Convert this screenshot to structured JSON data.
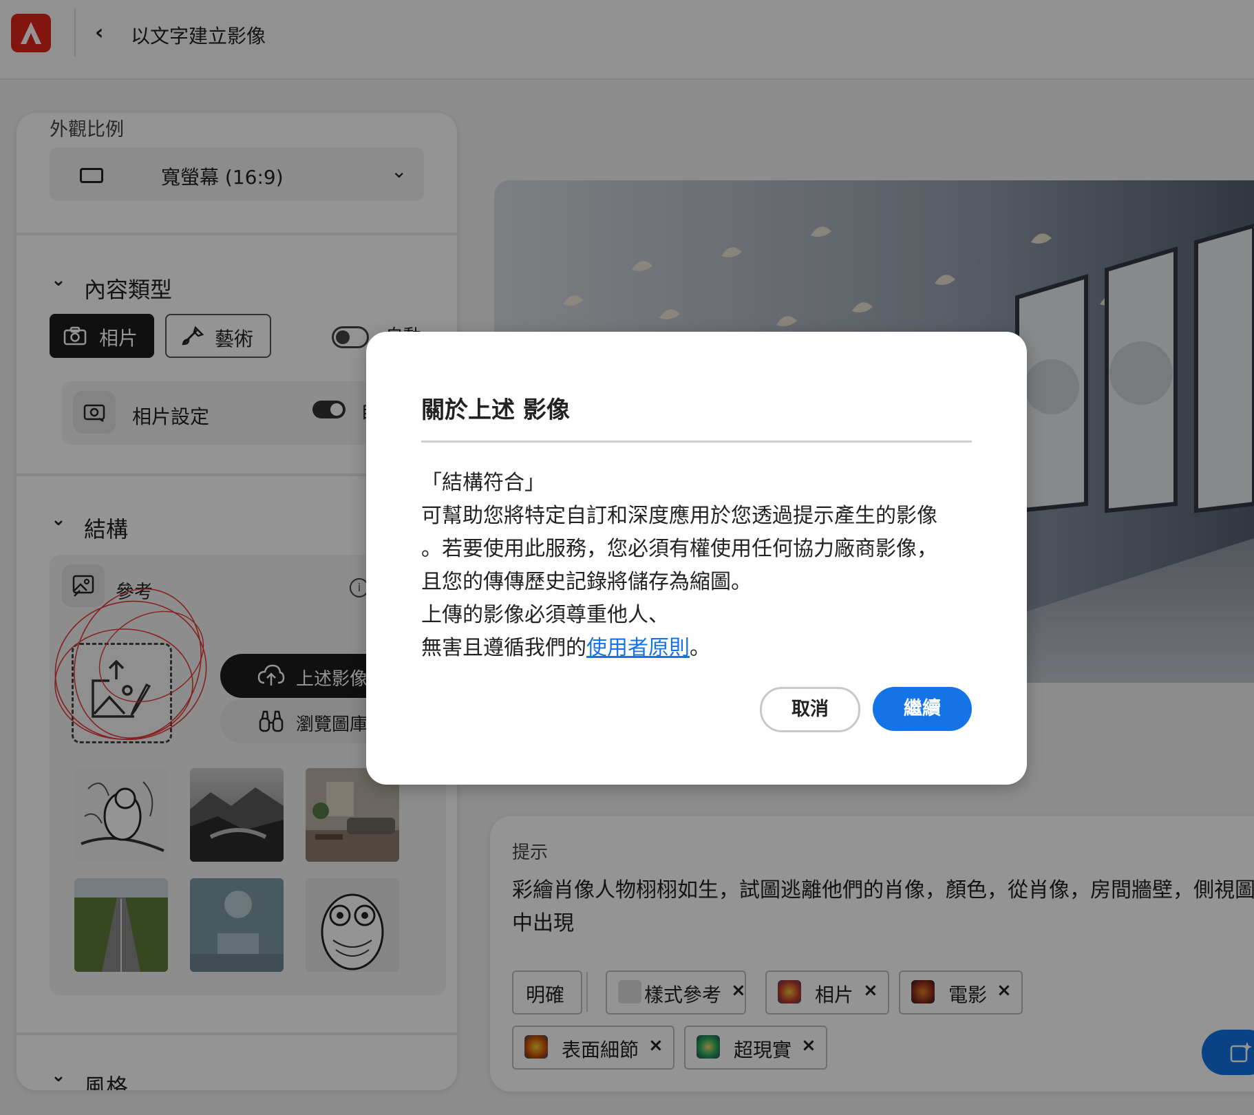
{
  "header": {
    "back_glyph": "‹",
    "title": "以文字建立影像"
  },
  "aspect": {
    "label": "外觀比例",
    "value": "寬螢幕 (16:9)"
  },
  "content_type": {
    "title": "內容類型",
    "photo_label": "相片",
    "art_label": "藝術",
    "auto_label": "自動",
    "photo_settings_label": "相片設定",
    "photo_settings_auto": "自動"
  },
  "structure": {
    "title": "結構",
    "reference_label": "參考",
    "upload_label": "上述影像",
    "browse_label": "瀏覽圖庫"
  },
  "style": {
    "title": "風格"
  },
  "prompt": {
    "label": "提示",
    "text": "彩繪肖像人物栩栩如生，試圖逃離他們的肖像，顏色，從肖像，房間牆壁，側視圖中出現",
    "chips": [
      "明確",
      "樣式參考",
      "相片",
      "電影",
      "表面細節",
      "超現實"
    ]
  },
  "modal": {
    "title": "關於上述 影像",
    "line1": "「結構符合」",
    "line2": "可幫助您將特定自訂和深度應用於您透過提示產生的影像",
    "line3": "。若要使用此服務，您必須有權使用任何協力廠商影像，",
    "line4": "且您的傳傳歷史記錄將儲存為縮圖。",
    "line5": "上傳的影像必須尊重他人、",
    "line6_prefix": "無害且遵循我們的",
    "link_text": "使用者原則",
    "line6_suffix": "。",
    "cancel_label": "取消",
    "continue_label": "繼續"
  },
  "colors": {
    "accent": "#1473e6",
    "logo": "#e1251b",
    "dark_button": "#1d1d1d"
  }
}
